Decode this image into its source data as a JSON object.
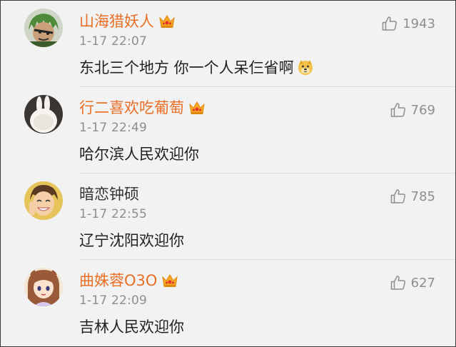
{
  "comments": [
    {
      "author": "山海猎妖人",
      "vip": true,
      "time": "1-17 22:07",
      "text": "东北三个地方  你一个人呆仨省啊",
      "emoji": "doge-emoji",
      "likes": "1943",
      "avatar": "avatar-green-hair-cartoon"
    },
    {
      "author": "行二喜欢吃葡萄",
      "vip": true,
      "time": "1-17 22:49",
      "text": "哈尔滨人民欢迎你",
      "likes": "769",
      "avatar": "avatar-white-bunny"
    },
    {
      "author": "暗恋钟硕",
      "vip": false,
      "time": "1-17 22:55",
      "text": "辽宁沈阳欢迎你",
      "likes": "785",
      "avatar": "avatar-smiling-boy"
    },
    {
      "author": "曲姝蓉O3O",
      "vip": true,
      "time": "1-17 22:09",
      "text": "吉林人民欢迎你",
      "likes": "627",
      "avatar": "avatar-anime-girl"
    }
  ],
  "icons": {
    "like": "thumbs-up-icon",
    "vip": "crown-icon"
  },
  "colors": {
    "vip_name": "#ea6f26",
    "normal_name": "#333333",
    "meta": "#8e8e8e",
    "background": "#f2f2f2"
  }
}
